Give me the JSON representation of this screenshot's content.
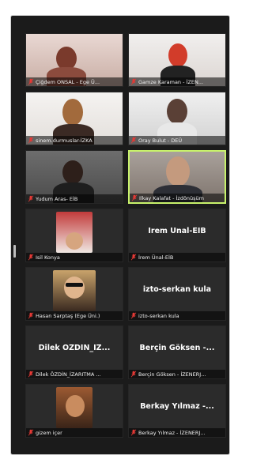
{
  "participants": [
    {
      "id": "p1",
      "name": "Çiğdem ONSAL - Ege Ü...",
      "big_name": ""
    },
    {
      "id": "p2",
      "name": "Gamze Karaman - İZEN...",
      "big_name": ""
    },
    {
      "id": "p3",
      "name": "sinem.durmuslar-İZKA",
      "big_name": ""
    },
    {
      "id": "p4",
      "name": "Oray Bulut - DEÜ",
      "big_name": ""
    },
    {
      "id": "p5",
      "name": "Yudum Aras- EİB",
      "big_name": ""
    },
    {
      "id": "p6",
      "name": "Ilkay Kalafat - İzdönüşüm",
      "big_name": ""
    },
    {
      "id": "p7",
      "name": "Isil Konya",
      "big_name": ""
    },
    {
      "id": "p8",
      "name": "İrem Ünal-EİB",
      "big_name": "İrem Ünal-EİB"
    },
    {
      "id": "p9",
      "name": "Hasan Sarptaş (Ege Üni.)",
      "big_name": ""
    },
    {
      "id": "p10",
      "name": "izto-serkan kula",
      "big_name": "izto-serkan kula"
    },
    {
      "id": "p11",
      "name": "Dilek ÖZDİN_İZARITMA ...",
      "big_name": "Dilek ÖZDİN_İZ..."
    },
    {
      "id": "p12",
      "name": "Berçin Göksen - İZENERJ...",
      "big_name": "Berçin Göksen -..."
    },
    {
      "id": "p13",
      "name": "gizem içer",
      "big_name": ""
    },
    {
      "id": "p14",
      "name": "Berkay Yılmaz - İZENERJ...",
      "big_name": "Berkay Yılmaz -..."
    }
  ],
  "colors": {
    "background": "#1b1b1b",
    "tile": "#2b2b2b",
    "active_speaker_border": "#c8f26b",
    "muted_mic": "#e53935"
  },
  "icons": {
    "mic": "mic-muted-icon"
  }
}
